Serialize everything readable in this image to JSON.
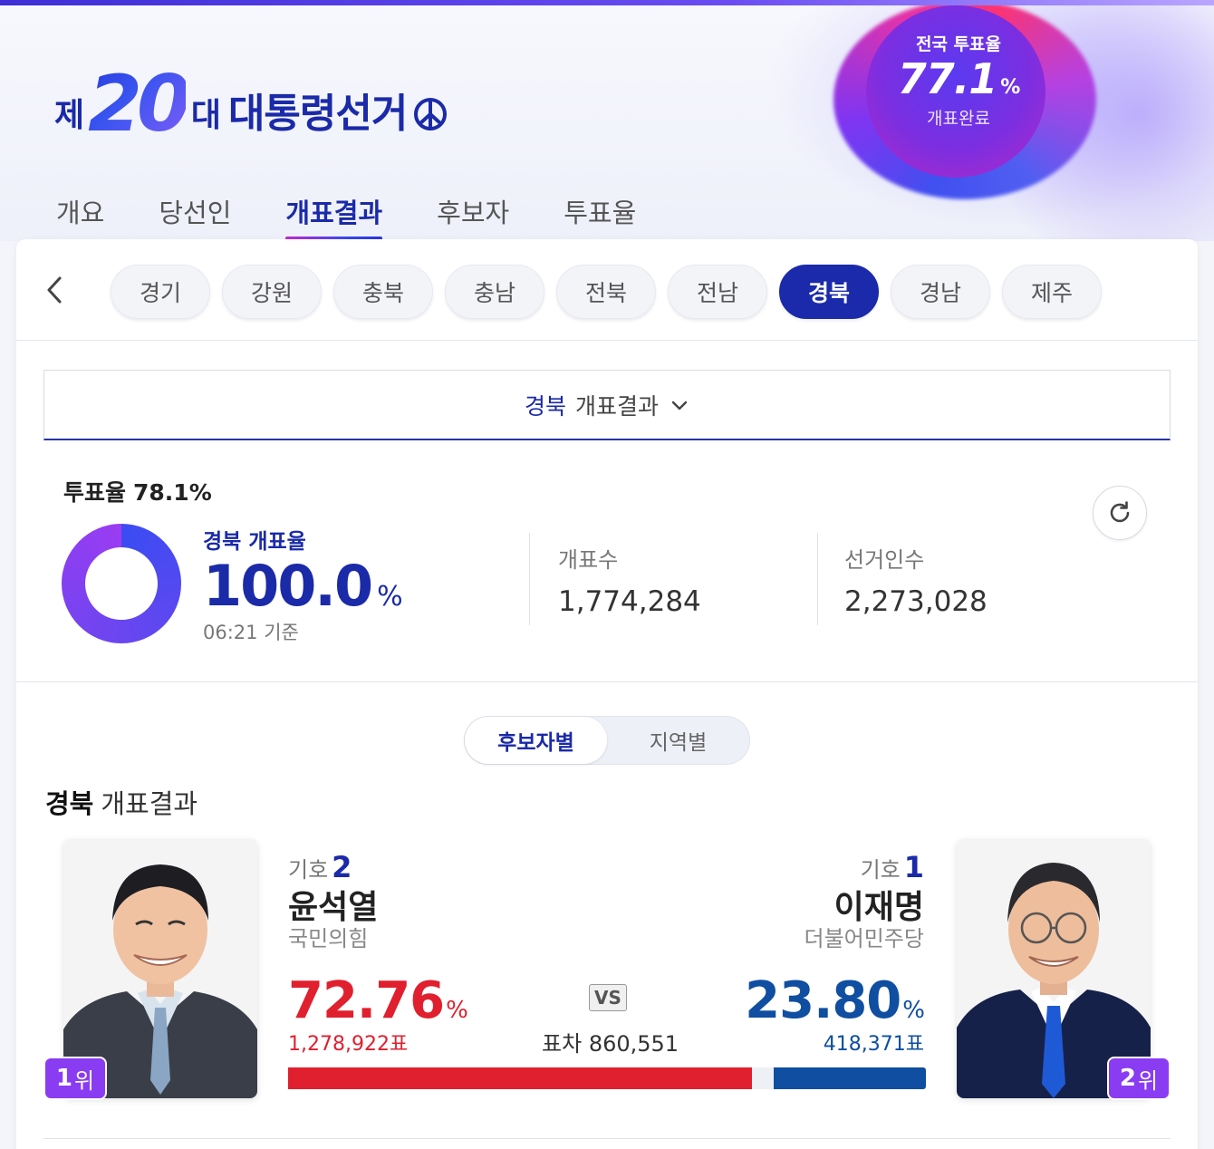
{
  "header": {
    "logo_prefix": "제",
    "logo_number": "20",
    "logo_suffix": "대",
    "logo_title": "대통령선거",
    "national_turnout": {
      "label": "전국 투표율",
      "value": "77.1",
      "unit": "%",
      "status": "개표완료"
    }
  },
  "main_tabs": [
    {
      "label": "개요",
      "active": false
    },
    {
      "label": "당선인",
      "active": false
    },
    {
      "label": "개표결과",
      "active": true
    },
    {
      "label": "후보자",
      "active": false
    },
    {
      "label": "투표율",
      "active": false
    }
  ],
  "regions": [
    "경기",
    "강원",
    "충북",
    "충남",
    "전북",
    "전남",
    "경북",
    "경남",
    "제주"
  ],
  "selected_region": "경북",
  "dropdown": {
    "region": "경북",
    "label": "개표결과"
  },
  "stats": {
    "turnout_label": "투표율",
    "turnout_value": "78.1%",
    "count_label": "경북 개표율",
    "count_rate": "100.0",
    "count_unit": "%",
    "count_rate_fraction": 1.0,
    "time": "06:21 기준",
    "counted_label": "개표수",
    "counted_value": "1,774,284",
    "electors_label": "선거인수",
    "electors_value": "2,273,028"
  },
  "view_toggle": [
    {
      "label": "후보자별",
      "active": true
    },
    {
      "label": "지역별",
      "active": false
    }
  ],
  "result_title": {
    "region": "경북",
    "label": "개표결과"
  },
  "candidates": {
    "left": {
      "symbol_label": "기호",
      "symbol_no": "2",
      "name": "윤석열",
      "party": "국민의힘",
      "pct": "72.76",
      "pct_unit": "%",
      "votes": "1,278,922표",
      "rank": "1",
      "rank_unit": "위",
      "color": "#e0202e",
      "share": 72.76
    },
    "right": {
      "symbol_label": "기호",
      "symbol_no": "1",
      "name": "이재명",
      "party": "더불어민주당",
      "pct": "23.80",
      "pct_unit": "%",
      "votes": "418,371표",
      "rank": "2",
      "rank_unit": "위",
      "color": "#0f4ea0",
      "share": 23.8
    },
    "vs_label": "VS",
    "gap_label": "표차",
    "gap_value": "860,551"
  },
  "colors": {
    "brand": "#1a2aa8",
    "accent_purple": "#8a3cf2",
    "red": "#e0202e",
    "blue": "#0f4ea0"
  }
}
